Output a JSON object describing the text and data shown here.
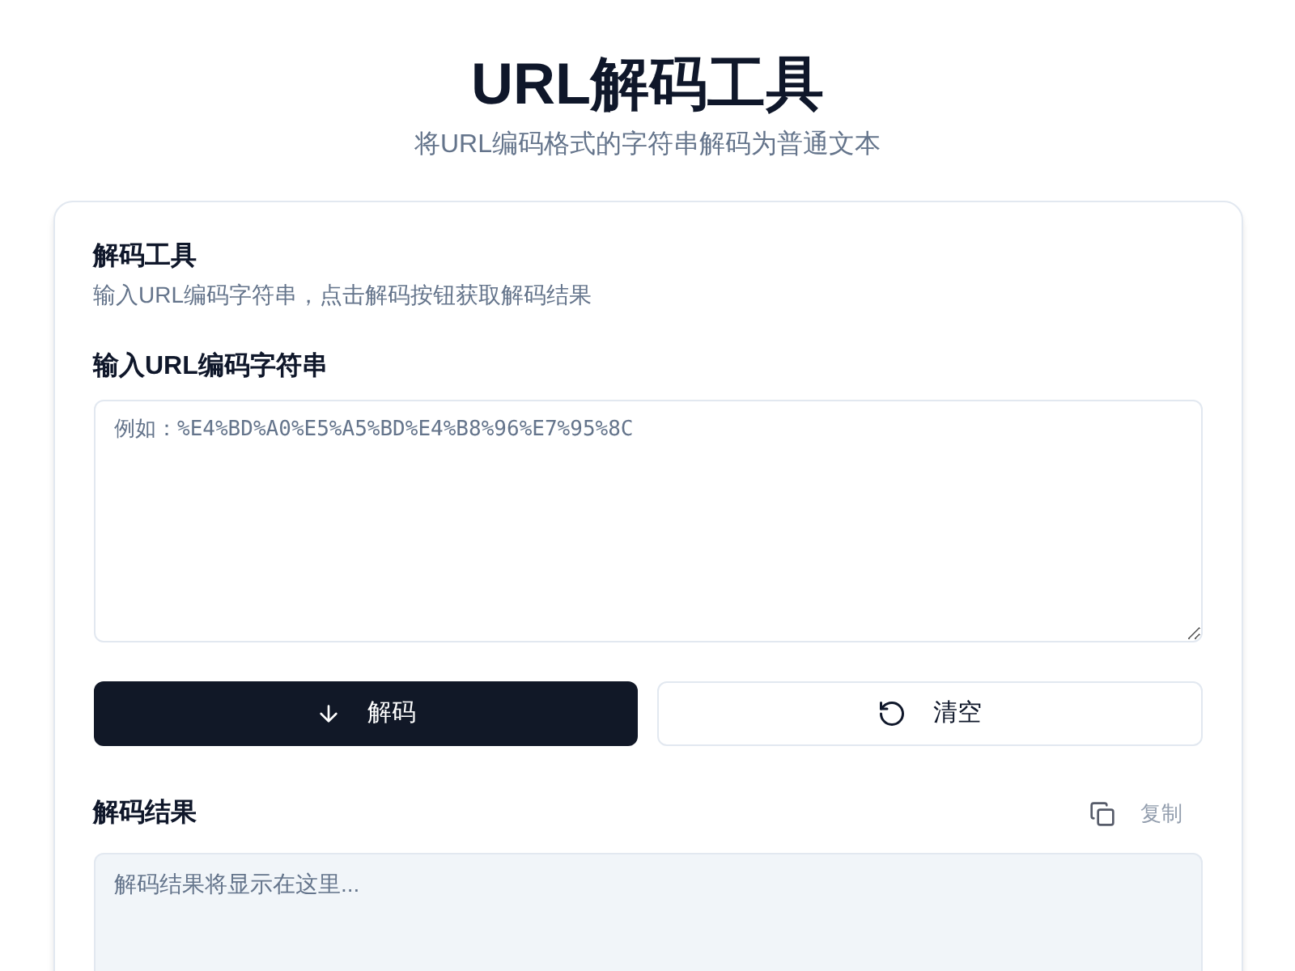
{
  "header": {
    "title": "URL解码工具",
    "subtitle": "将URL编码格式的字符串解码为普通文本"
  },
  "card": {
    "title": "解码工具",
    "description": "输入URL编码字符串，点击解码按钮获取解码结果",
    "input": {
      "label": "输入URL编码字符串",
      "placeholder": "例如：%E4%BD%A0%E5%A5%BD%E4%B8%96%E7%95%8C"
    },
    "buttons": [
      {
        "kind": "primary",
        "label": "解码"
      },
      {
        "kind": "secondary",
        "label": "清空"
      }
    ],
    "result": {
      "label": "解码结果",
      "copy": {
        "label": "复制",
        "disabled": true
      },
      "placeholder": "解码结果将显示在这里..."
    }
  }
}
